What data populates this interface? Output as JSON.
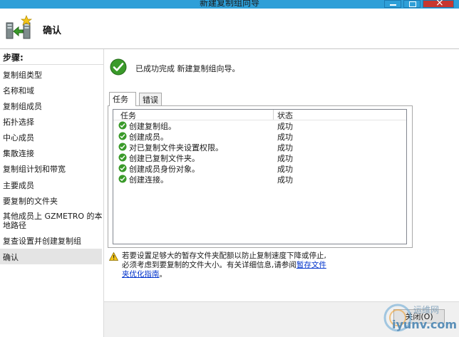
{
  "window": {
    "title": "新建复制组向导"
  },
  "header": {
    "title": "确认"
  },
  "sidebar": {
    "heading": "步骤:",
    "items": [
      {
        "label": "复制组类型"
      },
      {
        "label": "名称和域"
      },
      {
        "label": "复制组成员"
      },
      {
        "label": "拓扑选择"
      },
      {
        "label": "中心成员"
      },
      {
        "label": "集散连接"
      },
      {
        "label": "复制组计划和带宽"
      },
      {
        "label": "主要成员"
      },
      {
        "label": "要复制的文件夹"
      },
      {
        "label": "其他成员上 GZMETRO 的本地路径"
      },
      {
        "label": "复查设置并创建复制组"
      },
      {
        "label": "确认"
      }
    ]
  },
  "main": {
    "success_message": "已成功完成 新建复制组向导。",
    "tabs": [
      {
        "label": "任务"
      },
      {
        "label": "错误"
      }
    ],
    "table": {
      "columns": [
        "任务",
        "状态"
      ],
      "rows": [
        {
          "task": "创建复制组。",
          "status": "成功"
        },
        {
          "task": "创建成员。",
          "status": "成功"
        },
        {
          "task": "对已复制文件夹设置权限。",
          "status": "成功"
        },
        {
          "task": "创建已复制文件夹。",
          "status": "成功"
        },
        {
          "task": "创建成员身份对象。",
          "status": "成功"
        },
        {
          "task": "创建连接。",
          "status": "成功"
        }
      ]
    },
    "warning": {
      "line1": "若要设置足够大的暂存文件夹配额以防止复制速度下降或停止,",
      "line2_prefix": "必须考虑到要复制的文件大小。有关详细信息,请参阅",
      "link_part1": "暂存文件",
      "link_part2": "夹优化指南",
      "suffix": "。"
    }
  },
  "footer": {
    "close_label": "关闭(O)"
  },
  "watermark": {
    "line1": "运维网",
    "line2": "iyunv.com"
  },
  "colors": {
    "titlebar": "#2e9fd8",
    "close_button": "#c7372f",
    "success_green": "#3a9a2a",
    "link": "#0033cc"
  }
}
